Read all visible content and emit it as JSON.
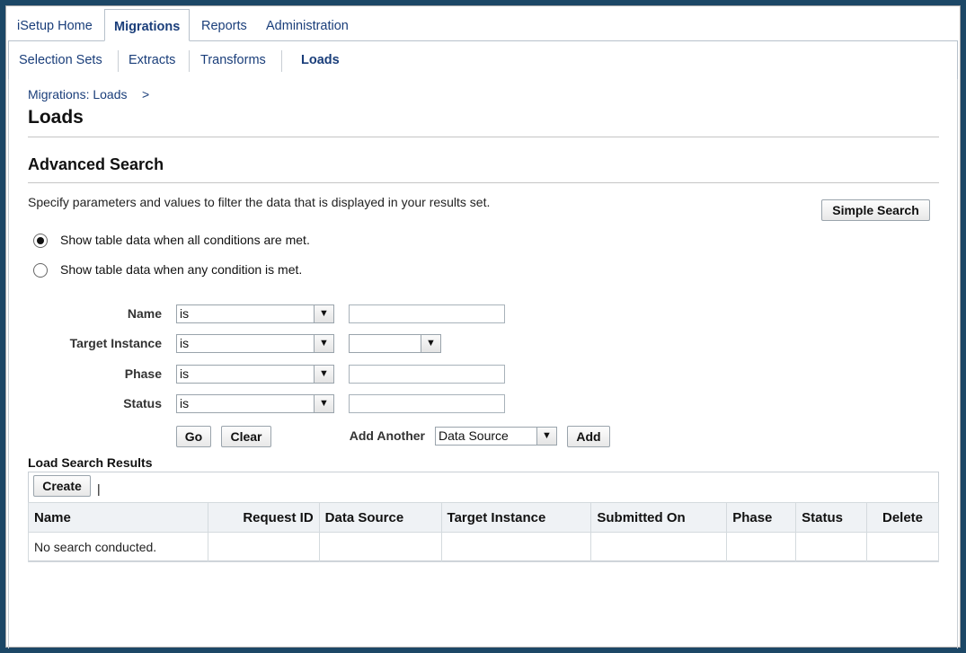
{
  "tabs": [
    {
      "label": "iSetup Home",
      "active": false
    },
    {
      "label": "Migrations",
      "active": true
    },
    {
      "label": "Reports",
      "active": false
    },
    {
      "label": "Administration",
      "active": false
    }
  ],
  "subtabs": [
    {
      "label": "Selection Sets",
      "active": false
    },
    {
      "label": "Extracts",
      "active": false
    },
    {
      "label": "Transforms",
      "active": false
    },
    {
      "label": "Loads",
      "active": true
    }
  ],
  "breadcrumb": {
    "link": "Migrations: Loads",
    "separator": ">"
  },
  "page_title": "Loads",
  "search": {
    "title": "Advanced Search",
    "instructions": "Specify parameters and values to filter the data that is displayed in your results set.",
    "simple_search_label": "Simple Search",
    "match_all_label": "Show table data when all conditions are met.",
    "match_any_label": "Show table data when any condition is met.",
    "match_selected": "all",
    "fields": [
      {
        "label": "Name",
        "operator": "is",
        "value": ""
      },
      {
        "label": "Target Instance",
        "operator": "is",
        "value": ""
      },
      {
        "label": "Phase",
        "operator": "is",
        "value": ""
      },
      {
        "label": "Status",
        "operator": "is",
        "value": ""
      }
    ],
    "go_label": "Go",
    "clear_label": "Clear",
    "add_another_label": "Add Another",
    "add_another_selected": "Data Source",
    "add_label": "Add"
  },
  "results": {
    "title": "Load Search Results",
    "create_label": "Create",
    "toolbar_divider": "|",
    "columns": [
      "Name",
      "Request ID",
      "Data Source",
      "Target Instance",
      "Submitted On",
      "Phase",
      "Status",
      "Delete"
    ],
    "empty_message": "No search conducted."
  },
  "icons": {
    "dropdown": "chevron-down-icon"
  },
  "colors": {
    "frame": "#1c4766",
    "link": "#1a3e7a",
    "header_bg": "#eff2f5"
  }
}
